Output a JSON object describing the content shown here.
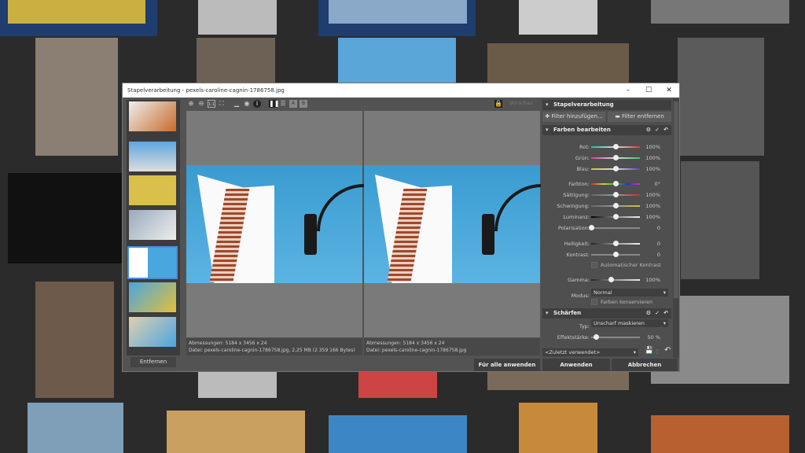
{
  "window": {
    "title": "Stapelverarbeitung - pexels-caroline-cagnin-1786758.jpg",
    "minimize": "–",
    "maximize": "☐",
    "close": "✕"
  },
  "toolbar": {
    "preview_label": "Vorschau",
    "icons": [
      "zoom-in-icon",
      "zoom-out-icon",
      "actual-size-icon",
      "fit-icon",
      "histogram-icon",
      "circle-icon",
      "info-icon",
      "split-vertical-icon",
      "split-horizontal-icon",
      "a-icon",
      "b-icon",
      "lock-icon"
    ]
  },
  "strip": {
    "remove_label": "Entfernen"
  },
  "previews": [
    {
      "dimensions": "Abmessungen: 5184 x 3456 x 24",
      "file": "Datei: pexels-caroline-cagnin-1786758.jpg, 2,25 MB (2 359 166 Bytes)"
    },
    {
      "dimensions": "Abmessungen: 5184 x 3456 x 24",
      "file": "Datei: pexels-caroline-cagnin-1786758.jpg"
    }
  ],
  "panel": {
    "header": "Stapelverarbeitung",
    "add_filter": "Filter hinzufügen...",
    "remove_filter": "Filter entfernen",
    "colors": {
      "title": "Farben bearbeiten",
      "rows": [
        {
          "label": "Rot:",
          "value": "100%",
          "pos": 0.5
        },
        {
          "label": "Grün:",
          "value": "100%",
          "pos": 0.5
        },
        {
          "label": "Blau:",
          "value": "100%",
          "pos": 0.5
        },
        {
          "label": "Farbton:",
          "value": "0°",
          "pos": 0.5
        },
        {
          "label": "Sättigung:",
          "value": "100%",
          "pos": 0.5
        },
        {
          "label": "Schwingung:",
          "value": "100%",
          "pos": 0.5
        },
        {
          "label": "Luminanz:",
          "value": "100%",
          "pos": 0.5
        },
        {
          "label": "Polarisation:",
          "value": "0",
          "pos": 0.0
        },
        {
          "label": "Helligkeit:",
          "value": "0",
          "pos": 0.5
        },
        {
          "label": "Kontrast:",
          "value": "0",
          "pos": 0.5
        },
        {
          "label": "Gamma:",
          "value": "100%",
          "pos": 0.4
        }
      ],
      "auto_contrast": "Automatischer Kontrast",
      "mode_label": "Modus:",
      "mode_value": "Normal",
      "preserve_colors": "Farben konservieren"
    },
    "sharpen": {
      "title": "Schärfen",
      "type_label": "Typ:",
      "type_value": "Unscharf maskieren",
      "strength_label": "Effektstärke:",
      "strength_value": "50 %",
      "strength_pos": 0.1
    },
    "preset": "<Zuletzt verwendet>"
  },
  "buttons": {
    "apply_all": "Für alle anwenden",
    "apply": "Anwenden",
    "cancel": "Abbrechen"
  }
}
